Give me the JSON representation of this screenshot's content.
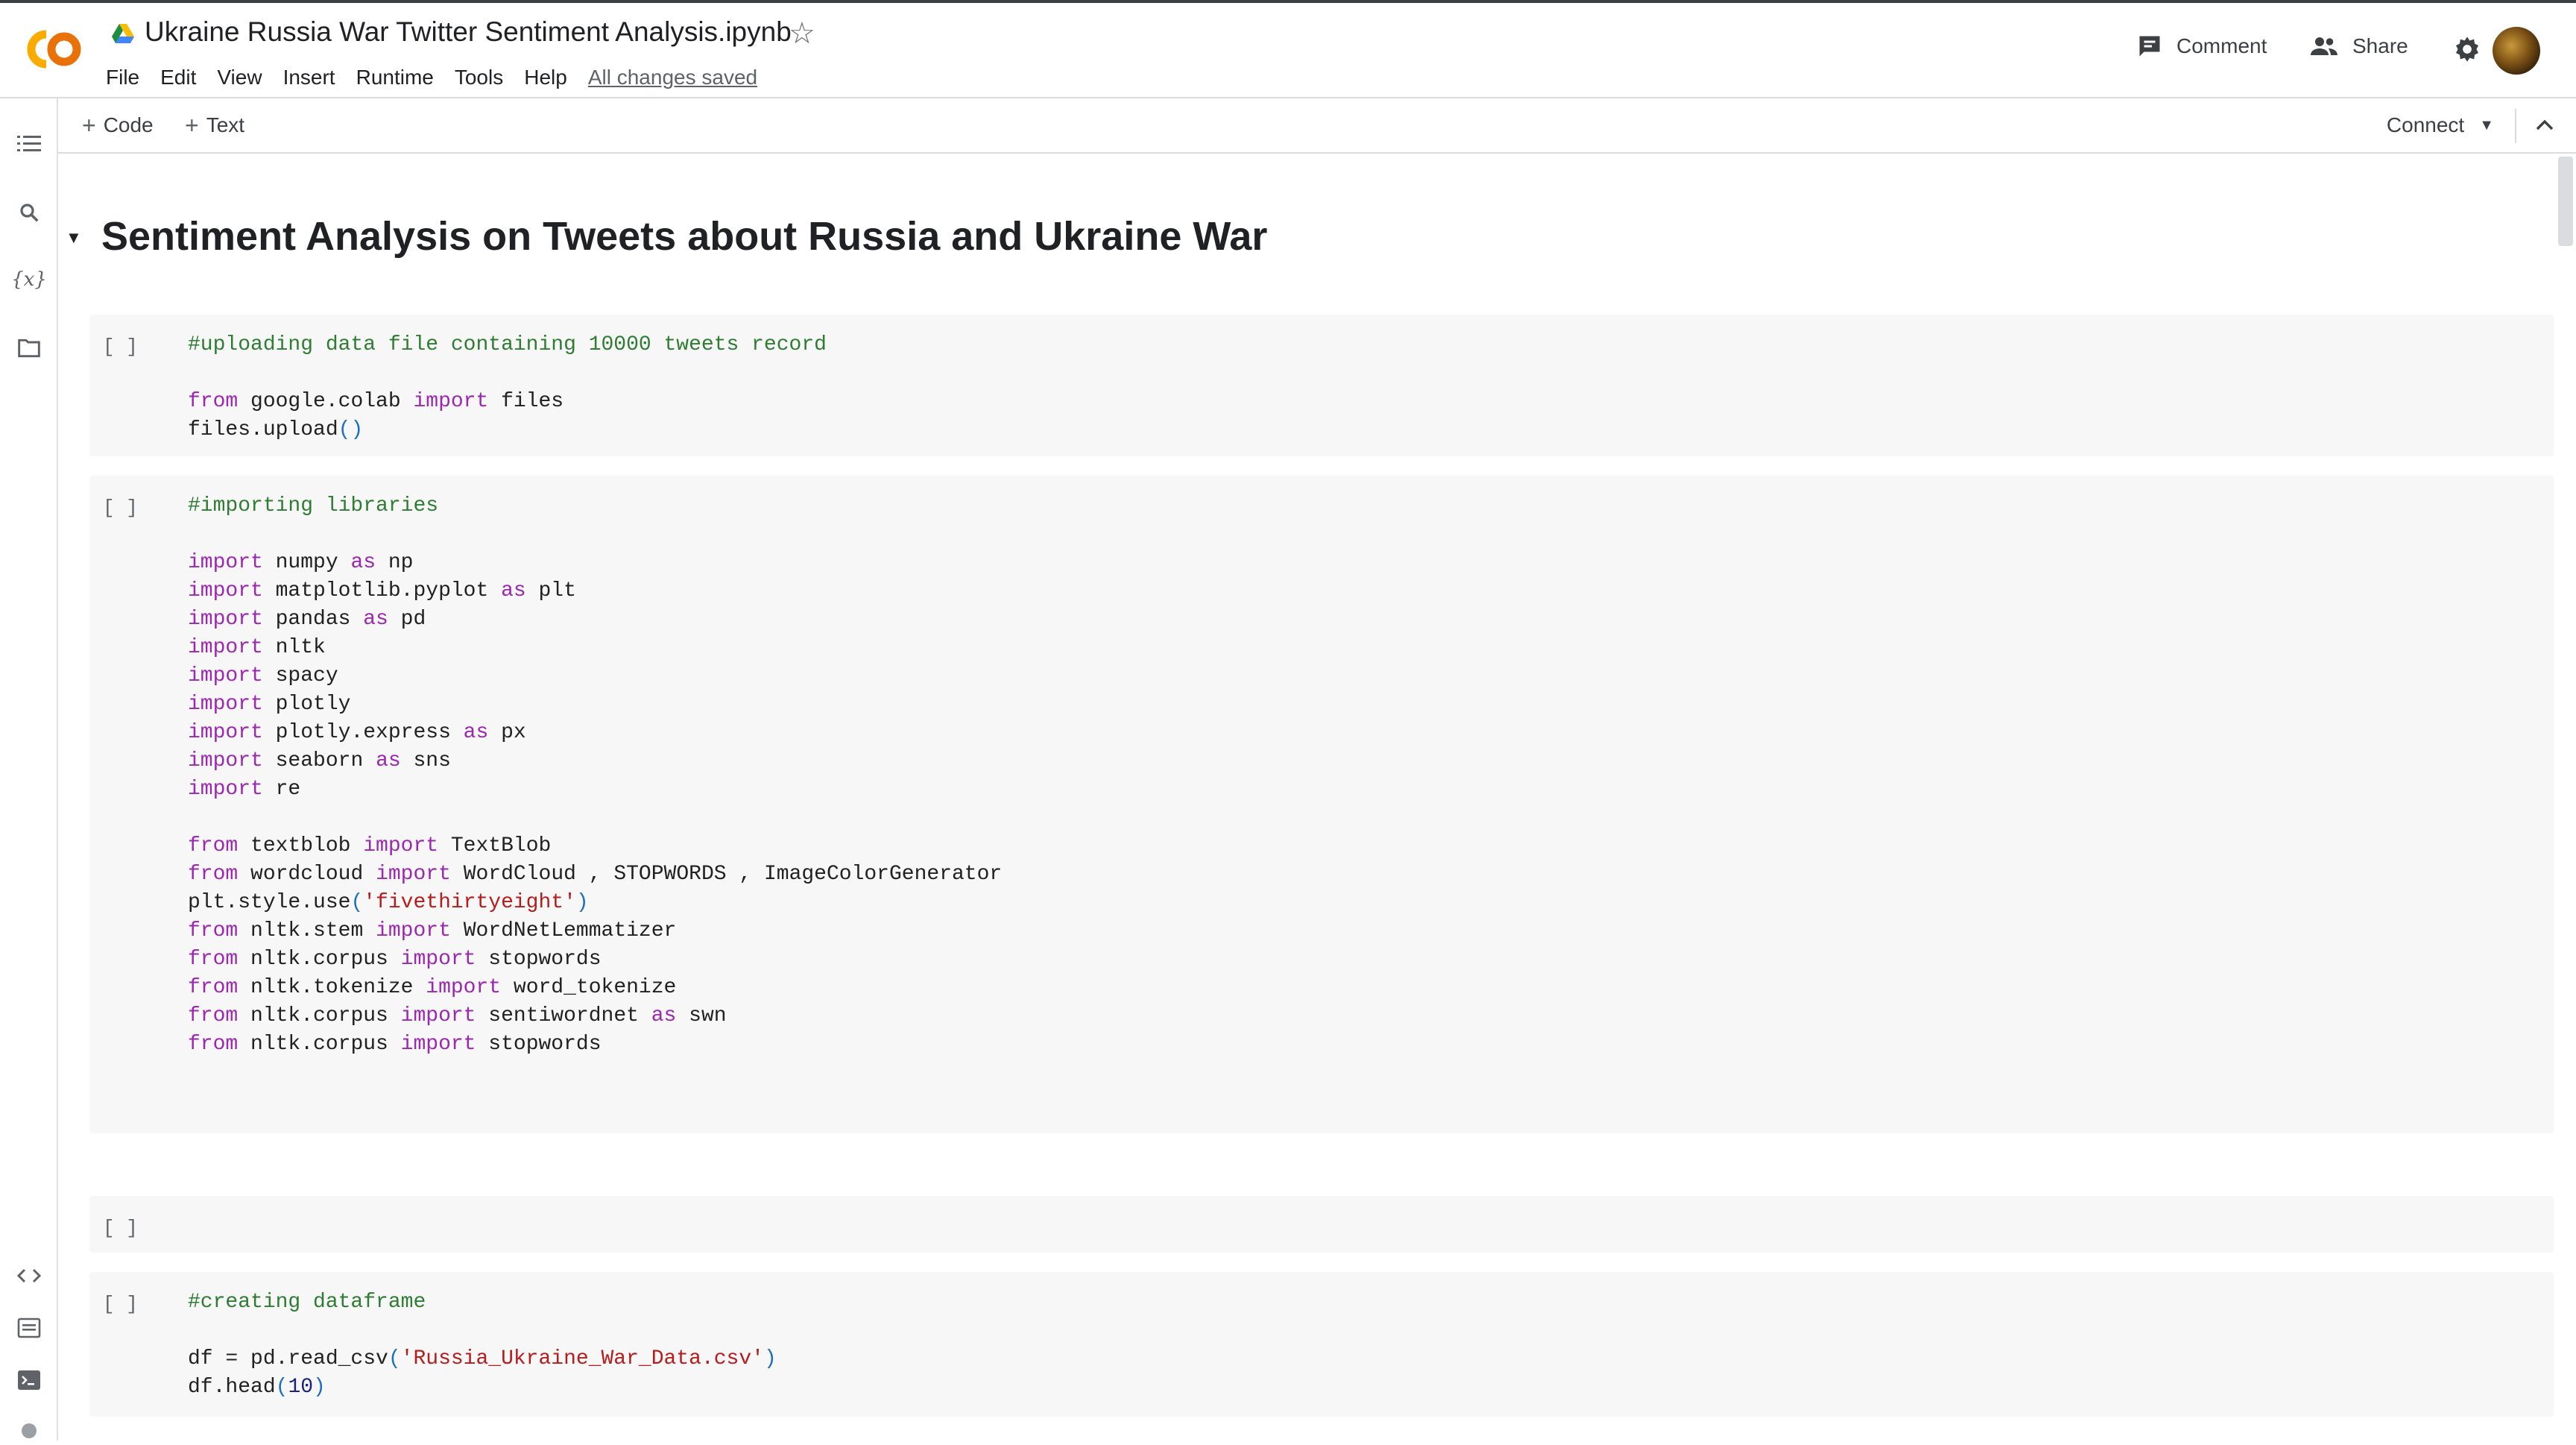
{
  "header": {
    "title": "Ukraine Russia War Twitter Sentiment Analysis.ipynb",
    "menu": [
      "File",
      "Edit",
      "View",
      "Insert",
      "Runtime",
      "Tools",
      "Help"
    ],
    "saved_status": "All changes saved",
    "comment_label": "Comment",
    "share_label": "Share",
    "logo_icon": "colab-logo",
    "brand_colors": {
      "logo_orange": "#f9ab00",
      "logo_dark_orange": "#e8710a"
    }
  },
  "toolbar": {
    "add_code_label": "Code",
    "add_text_label": "Text",
    "connect_label": "Connect"
  },
  "sidebar": {
    "icons": [
      "table-of-contents-icon",
      "search-icon",
      "variables-icon",
      "files-icon",
      "code-snippets-icon",
      "command-palette-icon",
      "terminal-icon",
      "status-icon"
    ],
    "variables_glyph": "{x}"
  },
  "notebook": {
    "section_title": "Sentiment Analysis on Tweets about Russia and Ukraine War",
    "run_indicator": "[ ]",
    "cells": [
      {
        "lines": [
          [
            [
              "cm",
              "#uploading data file containing 10000 tweets record"
            ]
          ],
          [],
          [
            [
              "kw",
              "from"
            ],
            [
              "tx",
              " google.colab "
            ],
            [
              "kw",
              "import"
            ],
            [
              "tx",
              " files"
            ]
          ],
          [
            [
              "tx",
              "files.upload"
            ],
            [
              "nb",
              "()"
            ]
          ]
        ]
      },
      {
        "lines": [
          [
            [
              "cm",
              "#importing libraries"
            ]
          ],
          [],
          [
            [
              "kw",
              "import"
            ],
            [
              "tx",
              " numpy "
            ],
            [
              "kw",
              "as"
            ],
            [
              "tx",
              " np"
            ]
          ],
          [
            [
              "kw",
              "import"
            ],
            [
              "tx",
              " matplotlib.pyplot "
            ],
            [
              "kw",
              "as"
            ],
            [
              "tx",
              " plt"
            ]
          ],
          [
            [
              "kw",
              "import"
            ],
            [
              "tx",
              " pandas "
            ],
            [
              "kw",
              "as"
            ],
            [
              "tx",
              " pd"
            ]
          ],
          [
            [
              "kw",
              "import"
            ],
            [
              "tx",
              " nltk"
            ]
          ],
          [
            [
              "kw",
              "import"
            ],
            [
              "tx",
              " spacy"
            ]
          ],
          [
            [
              "kw",
              "import"
            ],
            [
              "tx",
              " plotly"
            ]
          ],
          [
            [
              "kw",
              "import"
            ],
            [
              "tx",
              " plotly.express "
            ],
            [
              "kw",
              "as"
            ],
            [
              "tx",
              " px"
            ]
          ],
          [
            [
              "kw",
              "import"
            ],
            [
              "tx",
              " seaborn "
            ],
            [
              "kw",
              "as"
            ],
            [
              "tx",
              " sns"
            ]
          ],
          [
            [
              "kw",
              "import"
            ],
            [
              "tx",
              " re"
            ]
          ],
          [],
          [
            [
              "kw",
              "from"
            ],
            [
              "tx",
              " textblob "
            ],
            [
              "kw",
              "import"
            ],
            [
              "tx",
              " TextBlob"
            ]
          ],
          [
            [
              "kw",
              "from"
            ],
            [
              "tx",
              " wordcloud "
            ],
            [
              "kw",
              "import"
            ],
            [
              "tx",
              " WordCloud , STOPWORDS , ImageColorGenerator"
            ]
          ],
          [
            [
              "tx",
              "plt.style.use"
            ],
            [
              "nb",
              "("
            ],
            [
              "st",
              "'fivethirtyeight'"
            ],
            [
              "nb",
              ")"
            ]
          ],
          [
            [
              "kw",
              "from"
            ],
            [
              "tx",
              " nltk.stem "
            ],
            [
              "kw",
              "import"
            ],
            [
              "tx",
              " WordNetLemmatizer"
            ]
          ],
          [
            [
              "kw",
              "from"
            ],
            [
              "tx",
              " nltk.corpus "
            ],
            [
              "kw",
              "import"
            ],
            [
              "tx",
              " stopwords"
            ]
          ],
          [
            [
              "kw",
              "from"
            ],
            [
              "tx",
              " nltk.tokenize "
            ],
            [
              "kw",
              "import"
            ],
            [
              "tx",
              " word_tokenize"
            ]
          ],
          [
            [
              "kw",
              "from"
            ],
            [
              "tx",
              " nltk.corpus "
            ],
            [
              "kw",
              "import"
            ],
            [
              "tx",
              " sentiwordnet "
            ],
            [
              "kw",
              "as"
            ],
            [
              "tx",
              " swn"
            ]
          ],
          [
            [
              "kw",
              "from"
            ],
            [
              "tx",
              " nltk.corpus "
            ],
            [
              "kw",
              "import"
            ],
            [
              "tx",
              " stopwords"
            ]
          ]
        ]
      },
      {
        "lines": []
      },
      {
        "lines": [
          [
            [
              "cm",
              "#creating dataframe"
            ]
          ],
          [],
          [
            [
              "tx",
              "df = pd.read_csv"
            ],
            [
              "nb",
              "("
            ],
            [
              "st",
              "'Russia_Ukraine_War_Data.csv'"
            ],
            [
              "nb",
              ")"
            ]
          ],
          [
            [
              "tx",
              "df.head"
            ],
            [
              "nb",
              "("
            ],
            [
              "pn",
              "10"
            ],
            [
              "nb",
              ")"
            ]
          ]
        ]
      }
    ]
  }
}
